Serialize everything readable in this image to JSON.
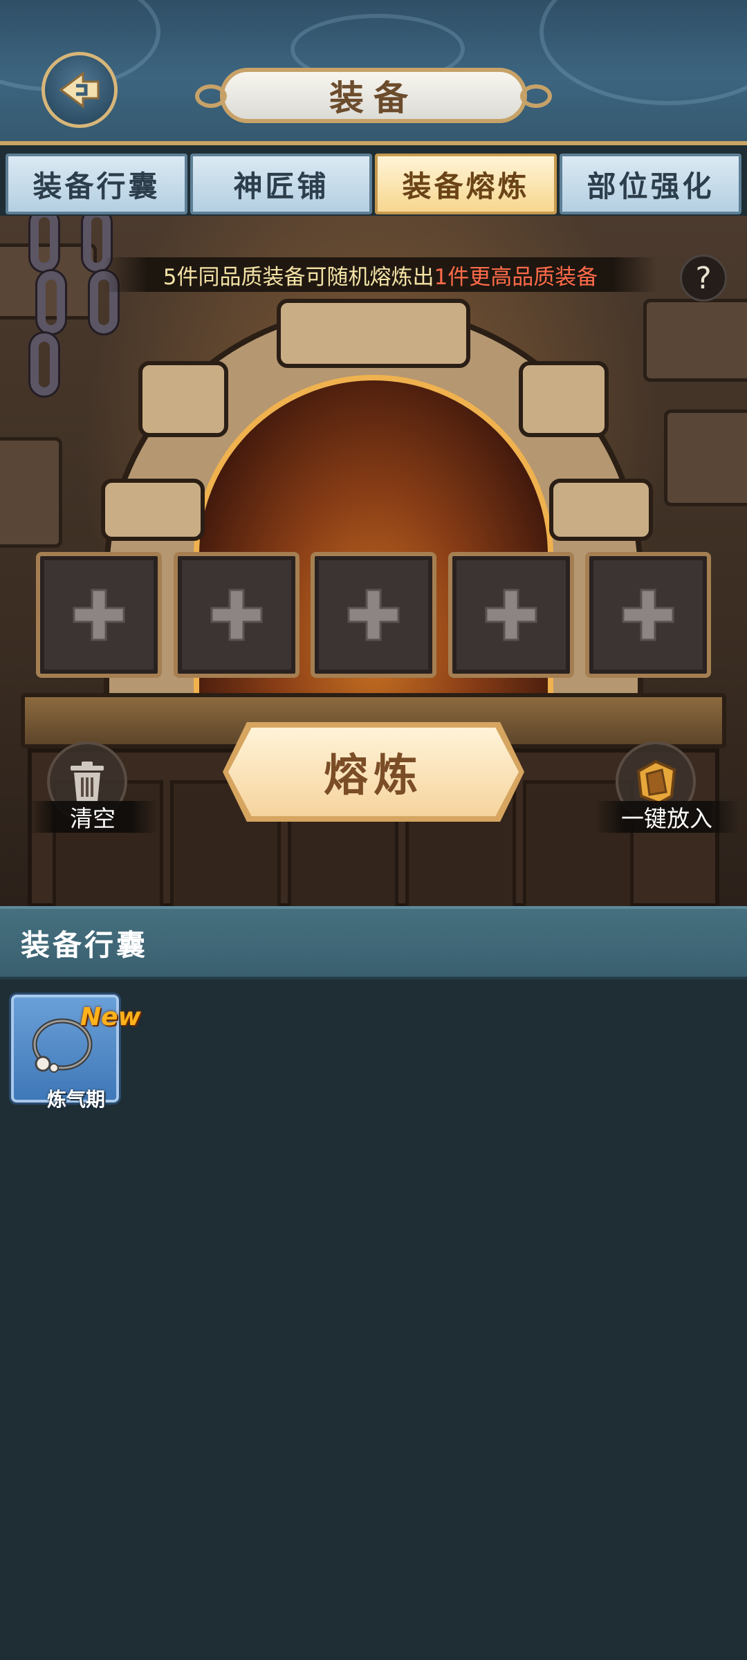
{
  "header": {
    "title": "装备",
    "back_icon": "back-arrow-icon"
  },
  "tabs": [
    {
      "label": "装备行囊",
      "active": false
    },
    {
      "label": "神匠铺",
      "active": false
    },
    {
      "label": "装备熔炼",
      "active": true
    },
    {
      "label": "部位强化",
      "active": false
    }
  ],
  "forge": {
    "info_text_prefix": "5件同品质装备可随机熔炼出",
    "info_text_highlight": "1件更高品质装备",
    "help_label": "?",
    "slots": [
      "+",
      "+",
      "+",
      "+",
      "+"
    ],
    "smelt_label": "熔炼",
    "clear_label": "清空",
    "auto_fill_label": "一键放入"
  },
  "bag": {
    "title": "装备行囊",
    "items": [
      {
        "badge": "New",
        "label": "炼气期",
        "icon": "necklace-icon"
      }
    ]
  },
  "colors": {
    "accent_gold": "#c9a565",
    "highlight_red": "#ff6b4a",
    "bag_bg": "#1f2e35"
  }
}
